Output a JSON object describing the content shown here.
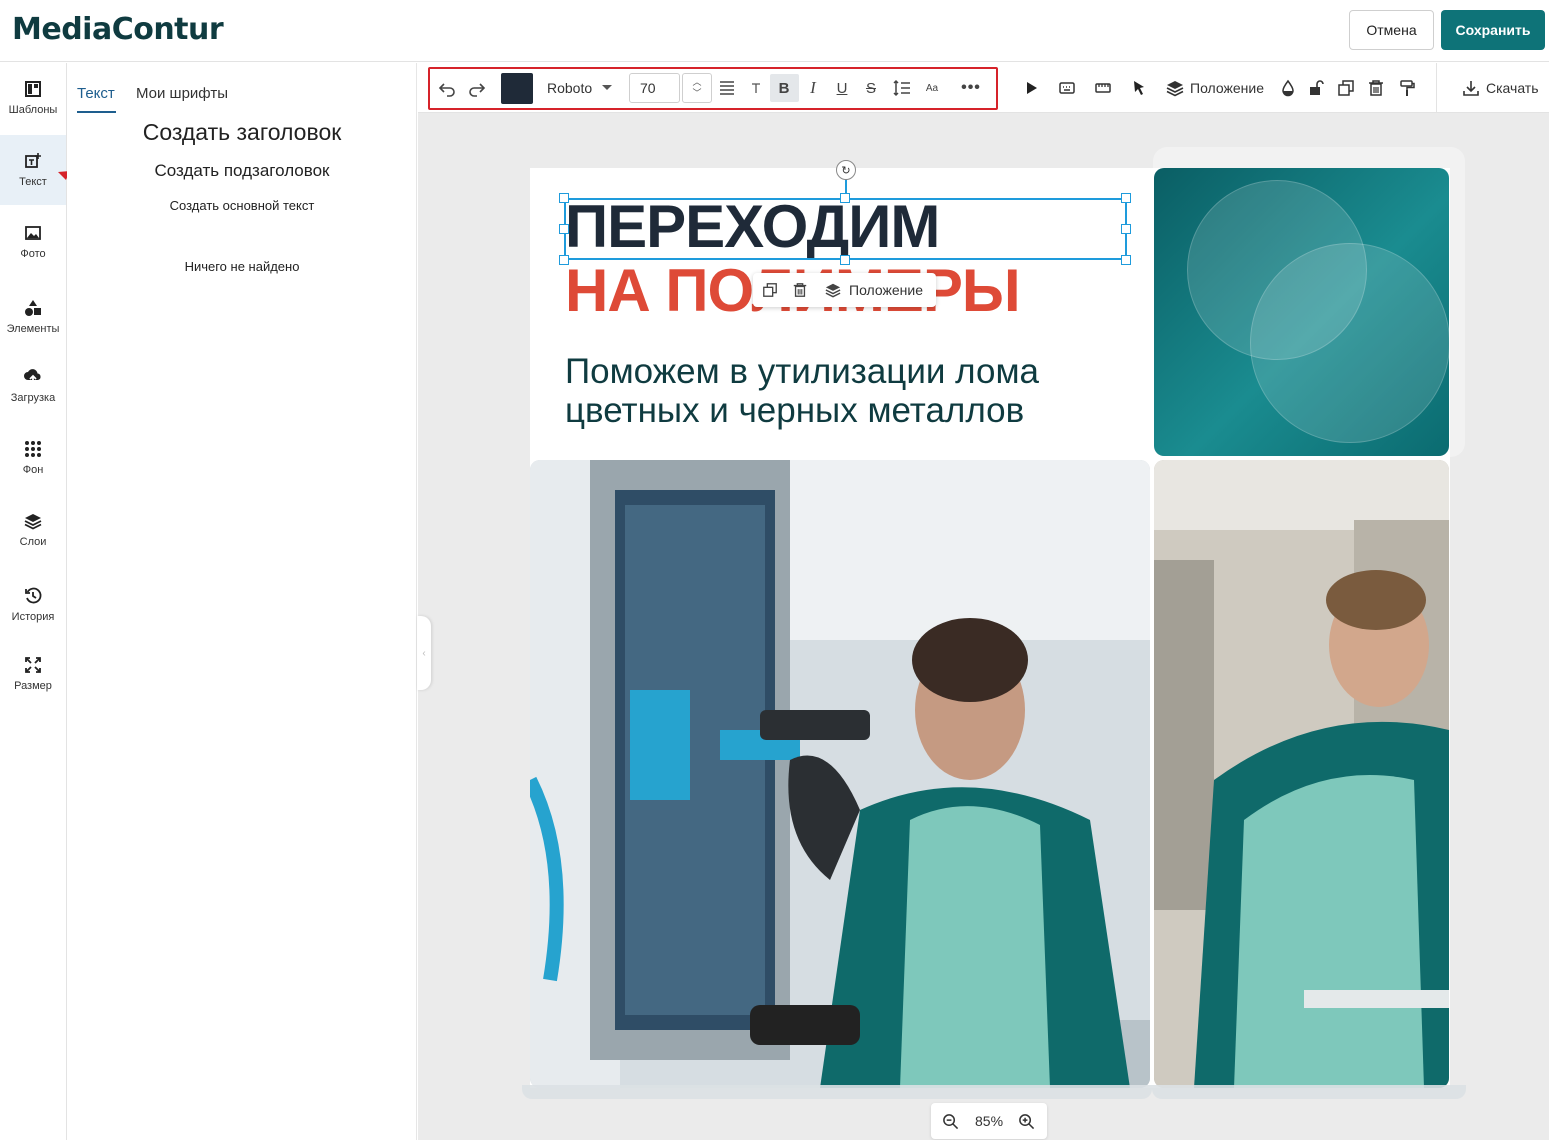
{
  "app": {
    "logo": "MediaContur",
    "cancel_label": "Отмена",
    "save_label": "Сохранить"
  },
  "rail": {
    "items": [
      {
        "label": "Шаблоны",
        "icon": "templates-icon"
      },
      {
        "label": "Текст",
        "icon": "text-add-icon"
      },
      {
        "label": "Фото",
        "icon": "photo-icon"
      },
      {
        "label": "Элементы",
        "icon": "shapes-icon"
      },
      {
        "label": "Загрузка",
        "icon": "upload-icon"
      },
      {
        "label": "Фон",
        "icon": "background-dots-icon"
      },
      {
        "label": "Слои",
        "icon": "layers-icon"
      },
      {
        "label": "История",
        "icon": "history-icon"
      },
      {
        "label": "Размер",
        "icon": "resize-icon"
      }
    ],
    "active": "Текст"
  },
  "panel": {
    "tabs": [
      "Текст",
      "Мои шрифты"
    ],
    "make_heading": "Создать заголовок",
    "make_subheading": "Создать подзаголовок",
    "make_body": "Создать основной текст",
    "empty_message": "Ничего не найдено"
  },
  "toolbar": {
    "text_color": "#1f2a38",
    "font_family": "Roboto",
    "font_size": "70",
    "position_label": "Положение",
    "download_label": "Скачать",
    "highlight_color": "#d6232a"
  },
  "canvas": {
    "headline_line1": "ПЕРЕХОДИМ",
    "headline_line2": "НА ПОЛИМЕРЫ",
    "headline_line2_color": "#de4a37",
    "subtitle": "Поможем в утилизации лома цветных и черных металлов",
    "context_menu_label": "Положение",
    "zoom": "85%"
  }
}
